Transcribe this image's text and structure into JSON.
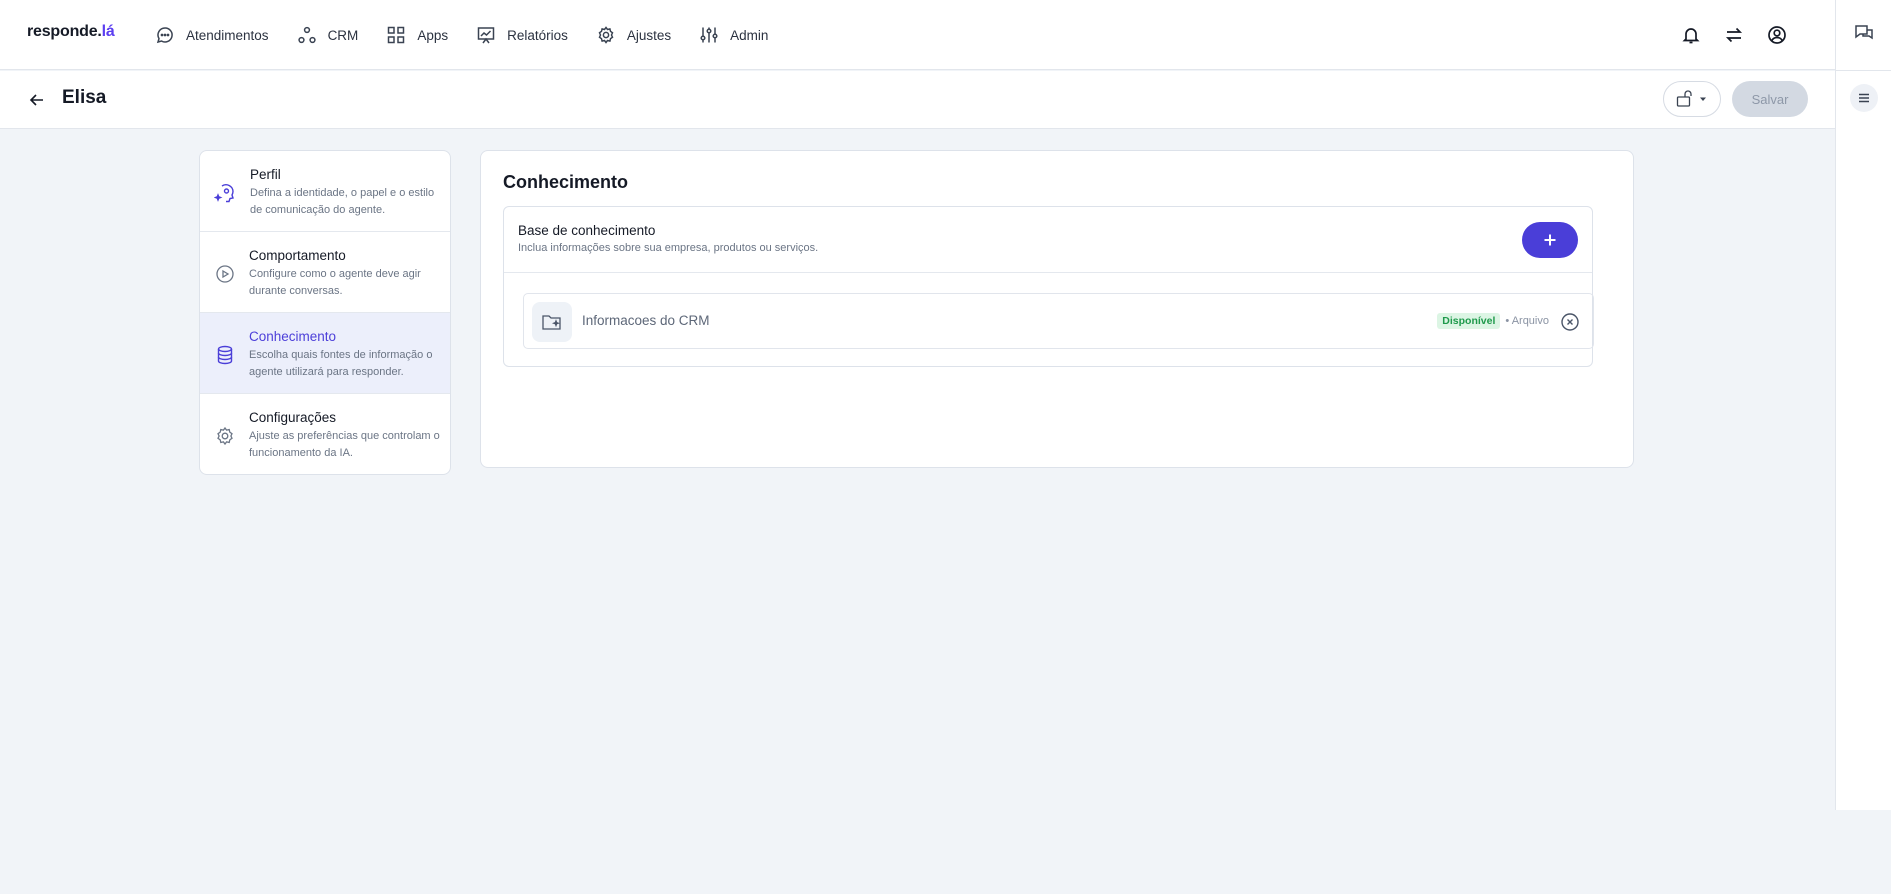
{
  "app": {
    "logo_main": "responde.",
    "logo_accent": "lá"
  },
  "nav": [
    {
      "label": "Atendimentos",
      "icon": "chat-bubble-icon"
    },
    {
      "label": "CRM",
      "icon": "crm-nodes-icon"
    },
    {
      "label": "Apps",
      "icon": "grid-icon"
    },
    {
      "label": "Relatórios",
      "icon": "chart-board-icon"
    },
    {
      "label": "Ajustes",
      "icon": "gear-icon"
    },
    {
      "label": "Admin",
      "icon": "sliders-icon"
    }
  ],
  "header": {
    "title": "Elisa",
    "save_label": "Salvar"
  },
  "menu": [
    {
      "title": "Perfil",
      "desc": "Defina a identidade, o papel e o estilo de comunicação do agente.",
      "icon": "profile-sparkle-icon"
    },
    {
      "title": "Comportamento",
      "desc": "Configure como o agente deve agir durante conversas.",
      "icon": "play-circle-icon"
    },
    {
      "title": "Conhecimento",
      "desc": "Escolha quais fontes de informação o agente utilizará para responder.",
      "icon": "database-icon"
    },
    {
      "title": "Configurações",
      "desc": "Ajuste as preferências que controlam o funcionamento da IA.",
      "icon": "gear-icon"
    }
  ],
  "content": {
    "title": "Conhecimento",
    "kb_title": "Base de conhecimento",
    "kb_subtitle": "Inclua informações sobre sua empresa, produtos ou serviços.",
    "items": [
      {
        "name": "Informacoes do CRM",
        "status": "Disponível",
        "type": "• Arquivo",
        "icon": "folder-sparkle-icon"
      }
    ]
  },
  "colors": {
    "accent": "#4a3ed8",
    "active_bg": "#eceffb",
    "status_green": "#1f9a4c"
  }
}
